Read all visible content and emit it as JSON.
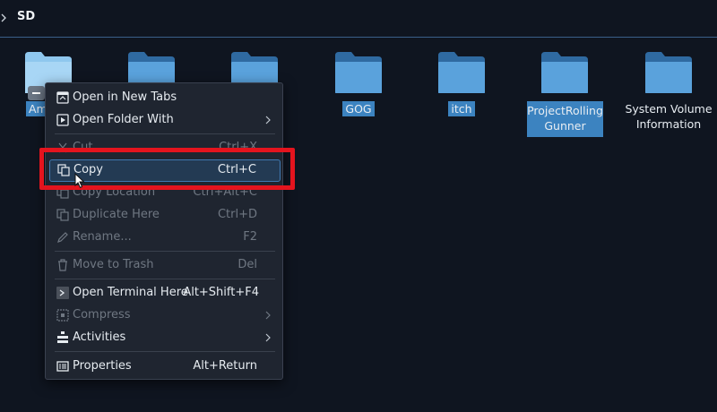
{
  "breadcrumb": {
    "label": "SD"
  },
  "files": [
    {
      "name": "Am",
      "selected": true
    },
    {
      "name": "",
      "selected": false
    },
    {
      "name": "",
      "selected": false
    },
    {
      "name": "GOG",
      "selected": true
    },
    {
      "name": "itch",
      "selected": true
    },
    {
      "name_line1": "ProjectRolling",
      "name_line2": "Gunner",
      "selected": true
    },
    {
      "name_line1": "System Volume",
      "name_line2": "Information",
      "selected": false
    }
  ],
  "menu": {
    "items": [
      {
        "label": "Open in New Tabs",
        "shortcut": "",
        "icon": "new-tabs-icon",
        "enabled": true
      },
      {
        "label": "Open Folder With",
        "shortcut": "",
        "icon": "open-with-icon",
        "enabled": true,
        "submenu": true
      },
      {
        "label": "Cut",
        "shortcut": "Ctrl+X",
        "icon": "cut-icon",
        "enabled": false
      },
      {
        "label": "Copy",
        "shortcut": "Ctrl+C",
        "icon": "copy-icon",
        "enabled": true,
        "highlighted": true
      },
      {
        "label": "Copy Location",
        "shortcut": "Ctrl+Alt+C",
        "icon": "copy-location-icon",
        "enabled": false
      },
      {
        "label": "Duplicate Here",
        "shortcut": "Ctrl+D",
        "icon": "duplicate-icon",
        "enabled": false
      },
      {
        "label": "Rename...",
        "shortcut": "F2",
        "icon": "rename-icon",
        "enabled": false
      },
      {
        "label": "Move to Trash",
        "shortcut": "Del",
        "icon": "trash-icon",
        "enabled": false
      },
      {
        "label": "Open Terminal Here",
        "shortcut": "Alt+Shift+F4",
        "icon": "terminal-icon",
        "enabled": true
      },
      {
        "label": "Compress",
        "shortcut": "",
        "icon": "compress-icon",
        "enabled": false,
        "submenu": true
      },
      {
        "label": "Activities",
        "shortcut": "",
        "icon": "activities-icon",
        "enabled": true,
        "submenu": true
      },
      {
        "label": "Properties",
        "shortcut": "Alt+Return",
        "icon": "properties-icon",
        "enabled": true
      }
    ]
  },
  "colors": {
    "background": "#0f1520",
    "folder": "#5aa2dc",
    "selection": "#3c83c0",
    "menu_bg": "#1f2530",
    "highlight_border": "#3f7ab3",
    "annotation_red": "#e4141e"
  }
}
